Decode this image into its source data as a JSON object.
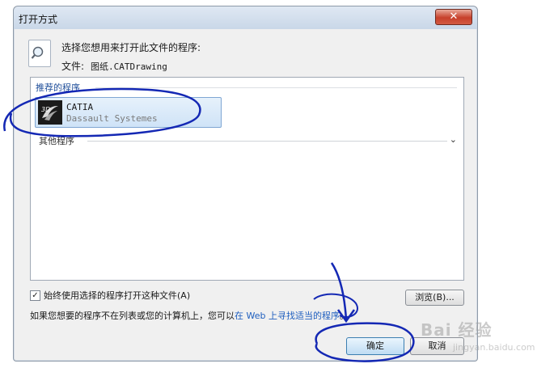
{
  "dialog": {
    "title": "打开方式",
    "close_symbol": "✕",
    "prompt": "选择您想用来打开此文件的程序:",
    "file_label": "文件:",
    "file_name": "图纸.CATDrawing"
  },
  "programs": {
    "recommended_heading": "推荐的程序",
    "items": [
      {
        "name": "CATIA",
        "vendor": "Dassault Systemes",
        "icon": "catia-3ds-logo-icon"
      }
    ],
    "other_heading": "其他程序",
    "expand_symbol": "⌄"
  },
  "always_use": {
    "label": "始终使用选择的程序打开这种文件(A)",
    "checked": true,
    "check_symbol": "✓"
  },
  "browse_label": "浏览(B)...",
  "info": {
    "prefix": "如果您想要的程序不在列表或您的计算机上，您可以",
    "link": "在 Web 上寻找适当的程序",
    "suffix": "。"
  },
  "buttons": {
    "ok": "确定",
    "cancel": "取消"
  },
  "watermark": {
    "text": "Bai 经验",
    "sub": "jingyan.baidu.com"
  },
  "colors": {
    "annotation": "#1428b4",
    "link": "#1f5fbf",
    "group_heading": "#1f4e9a"
  }
}
